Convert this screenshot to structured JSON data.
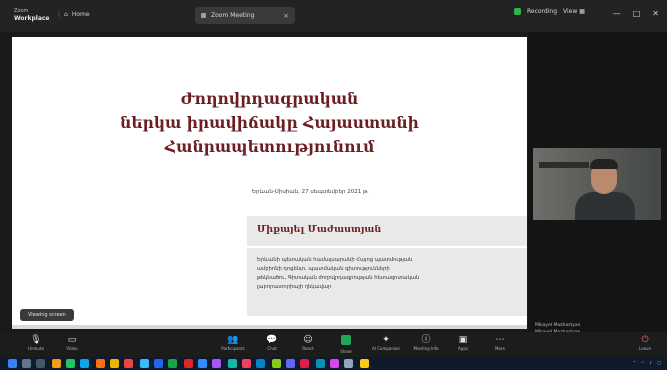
{
  "window": {
    "app_line1": "Zoom",
    "app_line2": "Workplace",
    "home_label": "Home",
    "meeting_tab_label": "Zoom Meeting"
  },
  "header": {
    "status_label": "Recording",
    "view_label": "View",
    "window_controls": [
      "—",
      "□",
      "✕"
    ]
  },
  "slide": {
    "title_lines": [
      "Ժողովրդագրական",
      "ներկա իրավիճակը Հայաստանի",
      "Հանրապետությունում"
    ],
    "place_date": "Երևան-Սիսիան, 27 սեպտեմբեր 2021 թ.",
    "presenter_name": "Միքայել Մաժաստյան",
    "bio_lines": [
      "Երևանի պետական համալսարանի Հայոց պատմության",
      "ամբիոնի դոցենտ, պատմական գիտությունների",
      "թեկնածու, Գիտական ժողովրդագրության հետազոտական",
      "լաբորատորիայի ղեկավար"
    ],
    "viewing_chip": "Viewing screen"
  },
  "participant_tile": {
    "name_line1": "Mikayel Mazhastyan",
    "name_line2": "Mikayel Mazhastyan"
  },
  "toolbar": {
    "items": [
      {
        "label": "Unmute",
        "icon": "microphone-icon"
      },
      {
        "label": "Video",
        "icon": "camera-icon"
      },
      {
        "label": "Participants",
        "icon": "participants-icon"
      },
      {
        "label": "Chat",
        "icon": "chat-icon"
      },
      {
        "label": "React",
        "icon": "react-icon"
      },
      {
        "label": "Share",
        "icon": "share-icon"
      },
      {
        "label": "AI Companion",
        "icon": "ai-icon"
      },
      {
        "label": "Meeting Info",
        "icon": "info-icon"
      },
      {
        "label": "Apps",
        "icon": "apps-icon"
      },
      {
        "label": "More",
        "icon": "more-icon"
      }
    ],
    "end_label": "Leave"
  },
  "colors": {
    "title_maroon": "#6b1f22",
    "share_green": "#23a55a",
    "status_green": "#2fb34a"
  }
}
